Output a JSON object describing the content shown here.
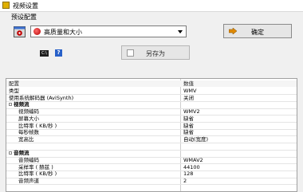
{
  "window": {
    "title": "视频设置"
  },
  "preset": {
    "label": "预设配置",
    "selected": "高质量和大小"
  },
  "buttons": {
    "ok_label": "确定",
    "save_as_label": "另存为",
    "cmd_icon_text": "C:\\"
  },
  "grid": {
    "header": {
      "name": "配置",
      "value": "数值"
    },
    "rows": [
      {
        "name": "类型",
        "value": "WMV",
        "section": false,
        "indent": 0
      },
      {
        "name": "使用系统解码器 (AviSynth)",
        "value": "关闭",
        "section": false,
        "indent": 0
      },
      {
        "name": "视频流",
        "value": "",
        "section": true,
        "indent": 1
      },
      {
        "name": "视频编码",
        "value": "WMV2",
        "section": false,
        "indent": 2
      },
      {
        "name": "屏幕大小",
        "value": "缺省",
        "section": false,
        "indent": 2
      },
      {
        "name": "比特率 ( KB/秒 )",
        "value": "缺省",
        "section": false,
        "indent": 2
      },
      {
        "name": "每秒帧数",
        "value": "缺省",
        "section": false,
        "indent": 2
      },
      {
        "name": "宽高比",
        "value": "自动(宽度)",
        "section": false,
        "indent": 2
      },
      {
        "name": "",
        "value": "",
        "section": false,
        "indent": 2
      },
      {
        "name": "音频流",
        "value": "",
        "section": true,
        "indent": 1
      },
      {
        "name": "音频编码",
        "value": "WMAV2",
        "section": false,
        "indent": 2
      },
      {
        "name": "采样率 ( 赫兹 )",
        "value": "44100",
        "section": false,
        "indent": 2
      },
      {
        "name": "比特率 ( KB/秒 )",
        "value": "128",
        "section": false,
        "indent": 2
      },
      {
        "name": "音频声道",
        "value": "2",
        "section": false,
        "indent": 2
      }
    ]
  }
}
